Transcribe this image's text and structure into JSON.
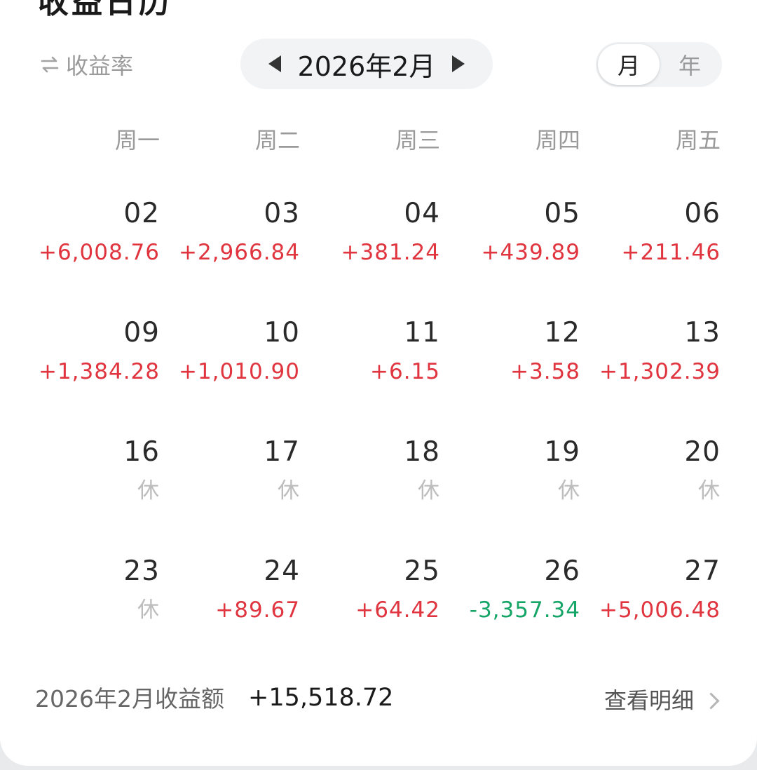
{
  "header": {
    "title": "收益日历"
  },
  "toolbar": {
    "rate_toggle_label": "收益率",
    "month_label": "2026年2月",
    "segments": [
      "月",
      "年"
    ],
    "active_segment": "月"
  },
  "weekdays": [
    "周一",
    "周二",
    "周三",
    "周四",
    "周五"
  ],
  "weeks": [
    [
      {
        "day": "02",
        "value": "+6,008.76",
        "status": "up"
      },
      {
        "day": "03",
        "value": "+2,966.84",
        "status": "up"
      },
      {
        "day": "04",
        "value": "+381.24",
        "status": "up"
      },
      {
        "day": "05",
        "value": "+439.89",
        "status": "up"
      },
      {
        "day": "06",
        "value": "+211.46",
        "status": "up"
      }
    ],
    [
      {
        "day": "09",
        "value": "+1,384.28",
        "status": "up"
      },
      {
        "day": "10",
        "value": "+1,010.90",
        "status": "up"
      },
      {
        "day": "11",
        "value": "+6.15",
        "status": "up"
      },
      {
        "day": "12",
        "value": "+3.58",
        "status": "up"
      },
      {
        "day": "13",
        "value": "+1,302.39",
        "status": "up"
      }
    ],
    [
      {
        "day": "16",
        "value": "休",
        "status": "off"
      },
      {
        "day": "17",
        "value": "休",
        "status": "off"
      },
      {
        "day": "18",
        "value": "休",
        "status": "off"
      },
      {
        "day": "19",
        "value": "休",
        "status": "off"
      },
      {
        "day": "20",
        "value": "休",
        "status": "off"
      }
    ],
    [
      {
        "day": "23",
        "value": "休",
        "status": "off"
      },
      {
        "day": "24",
        "value": "+89.67",
        "status": "up"
      },
      {
        "day": "25",
        "value": "+64.42",
        "status": "up"
      },
      {
        "day": "26",
        "value": "-3,357.34",
        "status": "down"
      },
      {
        "day": "27",
        "value": "+5,006.48",
        "status": "up"
      }
    ]
  ],
  "summary": {
    "label": "2026年2月收益额",
    "value": "+15,518.72",
    "detail_label": "查看明细"
  },
  "colors": {
    "gain": "#e0343f",
    "loss": "#14a567",
    "rest": "#bdbdbd"
  },
  "icons": {
    "rate_toggle": "swap-arrows-icon",
    "prev_month": "triangle-left-icon",
    "next_month": "triangle-right-icon",
    "detail": "chevron-right-icon"
  }
}
